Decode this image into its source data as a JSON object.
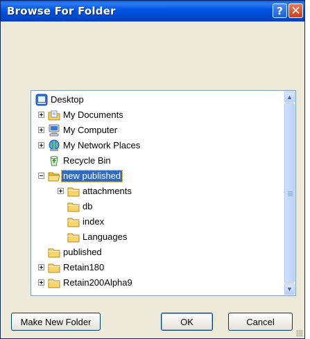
{
  "window": {
    "title": "Browse For Folder",
    "help_label": "?",
    "close_label": "✕"
  },
  "tree": {
    "items": [
      {
        "label": "Desktop",
        "icon": "desktop-icon",
        "expander": "none",
        "selected": false
      },
      {
        "label": "My Documents",
        "icon": "documents-folder-icon",
        "expander": "plus",
        "selected": false
      },
      {
        "label": "My Computer",
        "icon": "computer-icon",
        "expander": "plus",
        "selected": false
      },
      {
        "label": "My Network Places",
        "icon": "network-places-icon",
        "expander": "plus",
        "selected": false
      },
      {
        "label": "Recycle Bin",
        "icon": "recycle-bin-icon",
        "expander": "none",
        "selected": false
      },
      {
        "label": "new published",
        "icon": "open-folder-icon",
        "expander": "minus",
        "selected": true
      },
      {
        "label": "attachments",
        "icon": "folder-icon",
        "expander": "plus",
        "selected": false
      },
      {
        "label": "db",
        "icon": "folder-icon",
        "expander": "none",
        "selected": false
      },
      {
        "label": "index",
        "icon": "folder-icon",
        "expander": "none",
        "selected": false
      },
      {
        "label": "Languages",
        "icon": "folder-icon",
        "expander": "none",
        "selected": false
      },
      {
        "label": "published",
        "icon": "folder-icon",
        "expander": "none",
        "selected": false
      },
      {
        "label": "Retain180",
        "icon": "folder-icon",
        "expander": "plus",
        "selected": false
      },
      {
        "label": "Retain200Alpha9",
        "icon": "folder-icon",
        "expander": "plus",
        "selected": false
      }
    ]
  },
  "scrollbar": {
    "up_label": "▲",
    "down_label": "▼"
  },
  "buttons": {
    "make_new_folder": "Make New Folder",
    "ok": "OK",
    "cancel": "Cancel"
  },
  "colors": {
    "title_bar": "#0054e3",
    "selection": "#316ac5",
    "dialog_bg": "#ece9d8"
  }
}
